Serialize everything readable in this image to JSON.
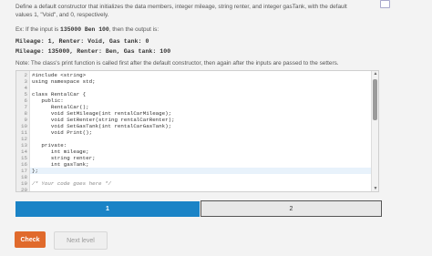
{
  "instructions": {
    "line1": "Define a default constructor that initializes the data members, integer mileage, string renter, and integer gasTank, with the default",
    "line2": "values 1, \"Void\", and 0, respectively."
  },
  "example": {
    "prefix": "Ex: If the input is",
    "input": "135000 Ben 100",
    "suffix": ", then the output is:"
  },
  "output_lines": [
    "Mileage: 1, Renter: Void, Gas tank: 0",
    "Mileage: 135000, Renter: Ben, Gas tank: 100"
  ],
  "note": "Note: The class's print function is called first after the default constructor, then again after the inputs are passed to the setters.",
  "code_lines": [
    {
      "num": "2",
      "text": "#include <string>"
    },
    {
      "num": "3",
      "text": "using namespace std;"
    },
    {
      "num": "4",
      "text": ""
    },
    {
      "num": "5",
      "text": "class RentalCar {"
    },
    {
      "num": "6",
      "text": "   public:"
    },
    {
      "num": "7",
      "text": "      RentalCar();"
    },
    {
      "num": "8",
      "text": "      void SetMileage(int rentalCarMileage);"
    },
    {
      "num": "9",
      "text": "      void SetRenter(string rentalCarRenter);"
    },
    {
      "num": "10",
      "text": "      void SetGasTank(int rentalCarGasTank);"
    },
    {
      "num": "11",
      "text": "      void Print();"
    },
    {
      "num": "12",
      "text": ""
    },
    {
      "num": "13",
      "text": "   private:"
    },
    {
      "num": "14",
      "text": "      int mileage;"
    },
    {
      "num": "15",
      "text": "      string renter;"
    },
    {
      "num": "16",
      "text": "      int gasTank;"
    },
    {
      "num": "17",
      "text": "};"
    },
    {
      "num": "18",
      "text": ""
    },
    {
      "num": "19",
      "text": "/* Your code goes here */"
    },
    {
      "num": "20",
      "text": ""
    }
  ],
  "progress": {
    "step1": "1",
    "step2": "2"
  },
  "buttons": {
    "check": "Check",
    "next": "Next level"
  },
  "colors": {
    "accent": "#1a83c6",
    "check": "#e06a2c"
  }
}
